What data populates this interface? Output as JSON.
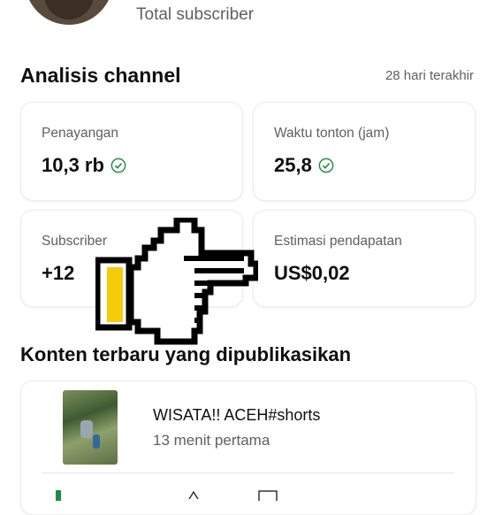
{
  "header": {
    "subscriber_label": "Total subscriber"
  },
  "analytics": {
    "title": "Analisis channel",
    "range": "28 hari terakhir",
    "cards": [
      {
        "label": "Penayangan",
        "value": "10,3 rb",
        "verified": true
      },
      {
        "label": "Waktu tonton (jam)",
        "value": "25,8",
        "verified": true
      },
      {
        "label": "Subscriber",
        "value": "+12",
        "verified": false
      },
      {
        "label": "Estimasi pendapatan",
        "value": "US$0,02",
        "verified": false
      }
    ]
  },
  "latest": {
    "title": "Konten terbaru yang dipublikasikan",
    "video": {
      "title": "WISATA!! ACEH#shorts",
      "subtitle": "13 menit pertama"
    }
  },
  "colors": {
    "check": "#1e8e3e",
    "text": "#0f0f0f",
    "muted": "#606060",
    "hand_fill": "#f4cc0a"
  },
  "icons": [
    "verified-check-icon",
    "pointing-hand-icon",
    "channel-avatar",
    "video-thumbnail"
  ]
}
